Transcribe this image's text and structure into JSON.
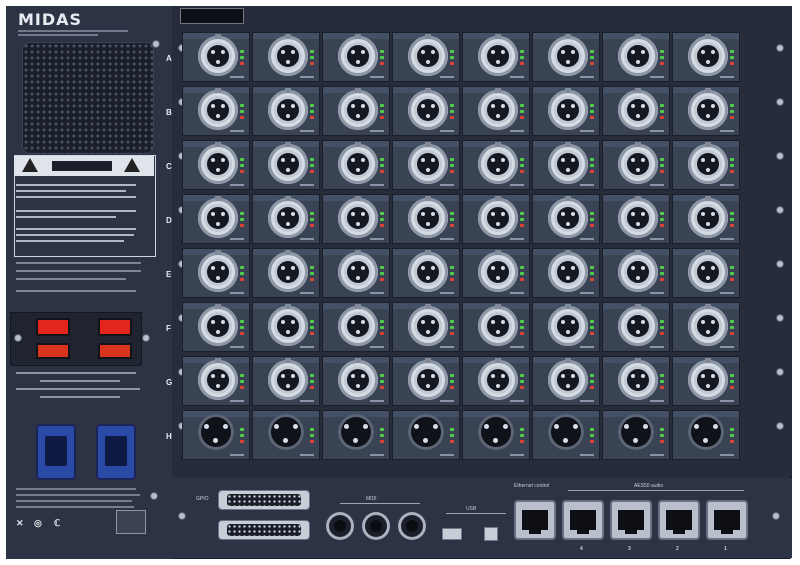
{
  "brand": {
    "logo": "MIDAS"
  },
  "panel": {
    "row_labels": [
      "A",
      "B",
      "C",
      "D",
      "E",
      "F",
      "G",
      "H"
    ],
    "bottom_labels": [
      "GPIO",
      "MIDI",
      "USB",
      "Ethernet control",
      "AES50 audio"
    ],
    "aes50_ports": [
      "4",
      "3",
      "2",
      "1"
    ]
  },
  "colors": {
    "chassis": "#272d3b",
    "card": "#3a4354",
    "power_switch": "#e3261c",
    "iec_inlet": "#2b4aa8",
    "led_green": "#4fd14a",
    "led_red": "#e64135"
  },
  "icons": [
    "xlr-female-connector-icon",
    "xlr-male-connector-icon",
    "power-switch-icon",
    "iec-power-inlet-icon",
    "ethercon-port-icon",
    "din-midi-port-icon",
    "usb-port-icon",
    "dsub-connector-icon",
    "warning-triangle-icon",
    "ce-mark-icon"
  ]
}
